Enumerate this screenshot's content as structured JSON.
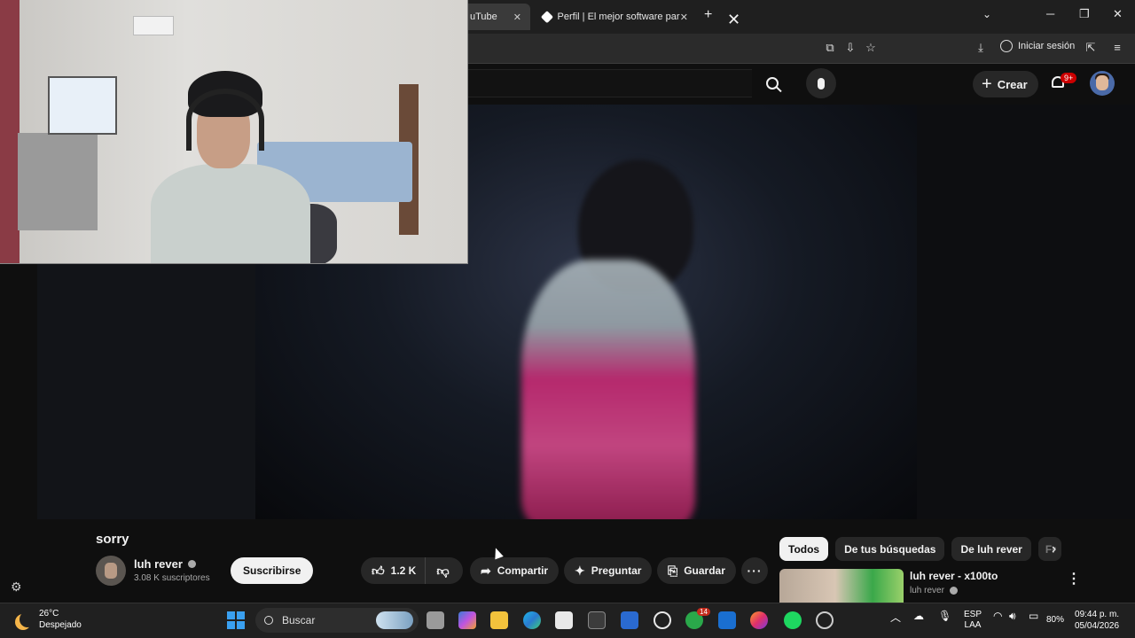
{
  "browser": {
    "tabs": [
      {
        "label": "uTube",
        "active": true
      },
      {
        "label": "Perfil | El mejor software para p",
        "active": false
      }
    ],
    "tab_close": "✕",
    "new_tab": "+",
    "sign_in": "Iniciar sesión"
  },
  "youtube": {
    "search_clear": "✕",
    "create_label": "Crear",
    "notification_badge": "9+",
    "video": {
      "title": "sorry",
      "channel": "luh rever",
      "subscribers": "3.08 K suscriptores",
      "subscribe_label": "Suscribirse",
      "likes": "1.2 K",
      "share_label": "Compartir",
      "ask_label": "Preguntar",
      "save_label": "Guardar"
    },
    "chips": [
      "Todos",
      "De tus búsquedas",
      "De luh rever",
      "Fr"
    ],
    "recommendation": {
      "title": "luh rever - x100to",
      "channel": "luh rever"
    }
  },
  "taskbar": {
    "weather_temp": "26°C",
    "weather_desc": "Despejado",
    "search_placeholder": "Buscar",
    "store_badge": "14",
    "language_line1": "ESP",
    "language_line2": "LAA",
    "battery": "80%",
    "time": "09:44 p. m.",
    "date": "05/04/2026"
  },
  "colors": {
    "yt_bg": "#0f0f0f",
    "pill_bg": "#272727",
    "accent_red": "#cc0000",
    "windows_blue": "#3aa0f0"
  }
}
